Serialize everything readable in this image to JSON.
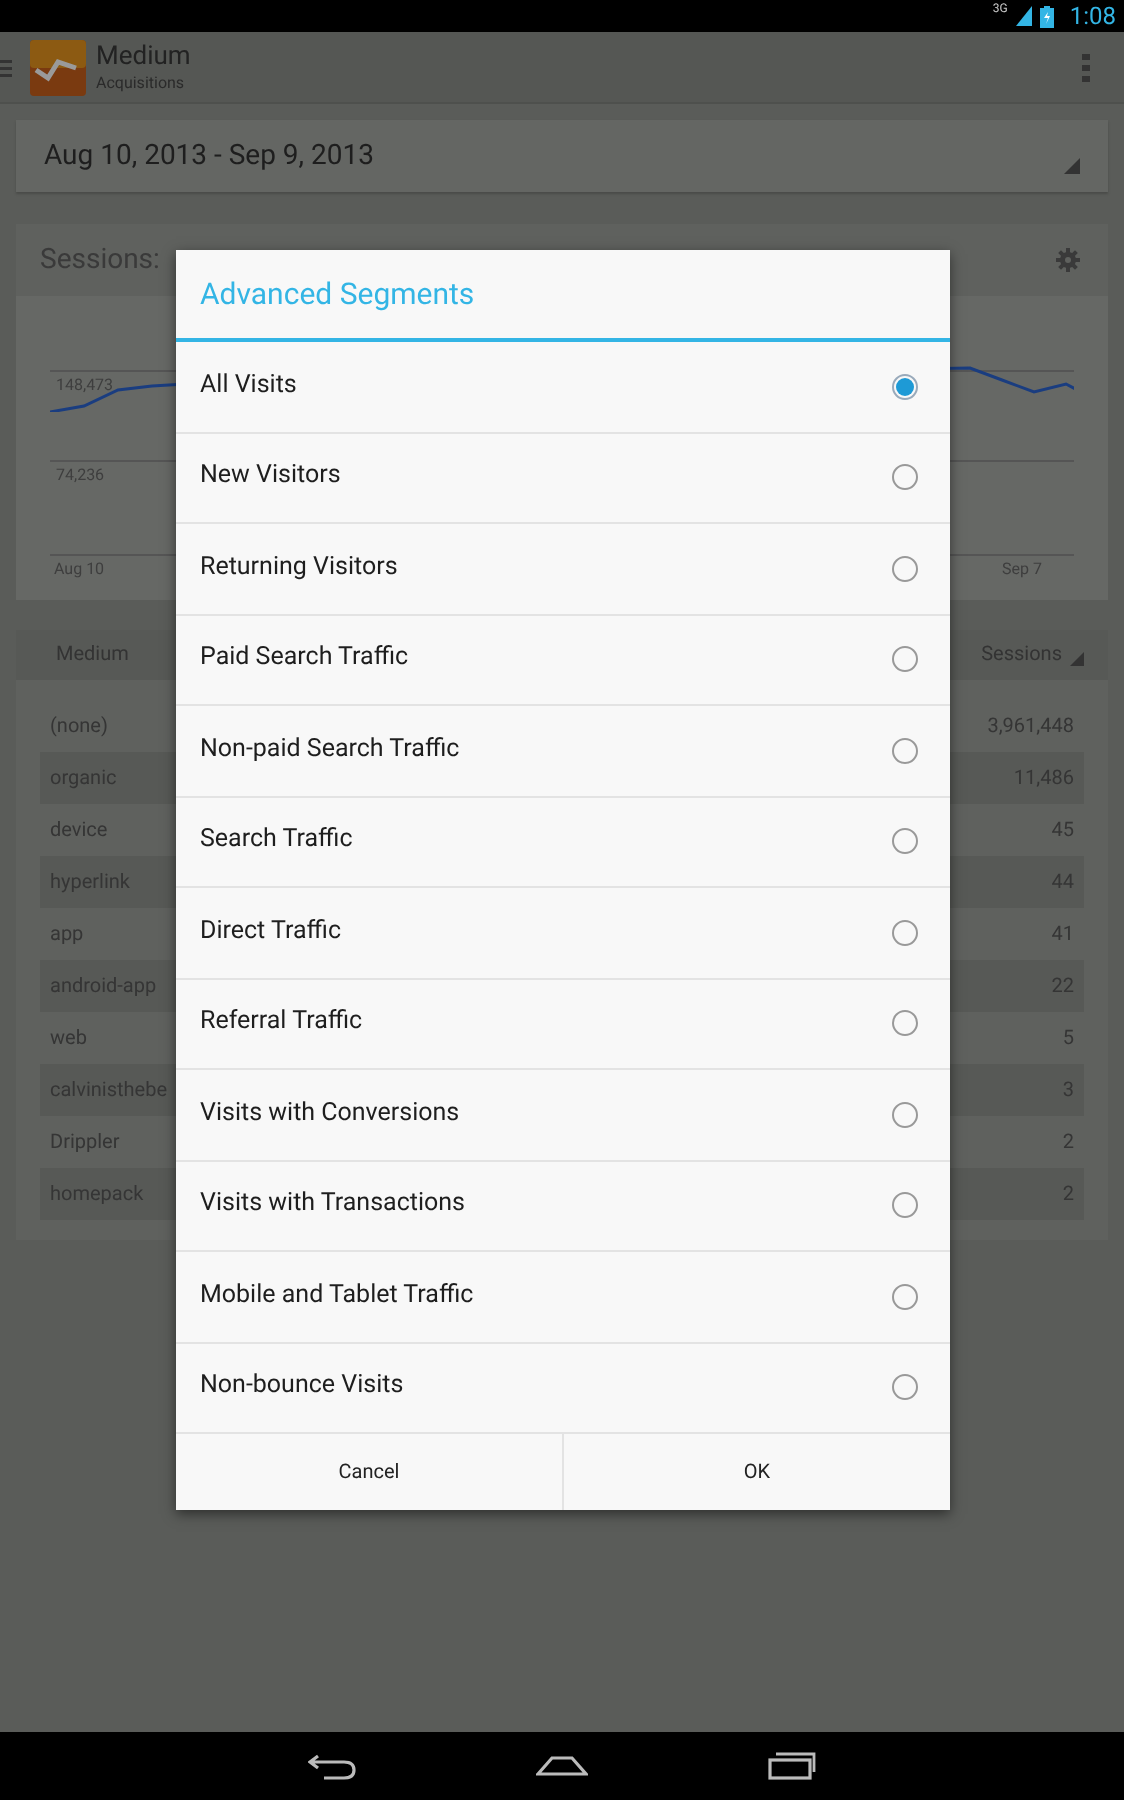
{
  "status_bar": {
    "network": "3G",
    "time": "1:08"
  },
  "action_bar": {
    "title": "Medium",
    "subtitle": "Acquisitions"
  },
  "date_range": "Aug 10, 2013 - Sep 9, 2013",
  "sessions_label": "Sessions:",
  "chart": {
    "y_labels": [
      "148,473",
      "74,236"
    ],
    "x_labels": [
      "Aug 10",
      "Sep 7"
    ]
  },
  "table": {
    "columns": [
      "Medium",
      "Sessions"
    ],
    "rows": [
      {
        "medium": "(none)",
        "sessions": "3,961,448"
      },
      {
        "medium": "organic",
        "sessions": "11,486"
      },
      {
        "medium": "device",
        "sessions": "45"
      },
      {
        "medium": "hyperlink",
        "sessions": "44"
      },
      {
        "medium": "app",
        "sessions": "41"
      },
      {
        "medium": "android-app",
        "sessions": "22"
      },
      {
        "medium": "web",
        "sessions": "5"
      },
      {
        "medium": "calvinisthebe",
        "sessions": "3"
      },
      {
        "medium": "Drippler",
        "sessions": "2"
      },
      {
        "medium": "homepack",
        "sessions": "2"
      }
    ]
  },
  "dialog": {
    "title": "Advanced Segments",
    "options": [
      {
        "label": "All Visits",
        "selected": true
      },
      {
        "label": "New Visitors",
        "selected": false
      },
      {
        "label": "Returning Visitors",
        "selected": false
      },
      {
        "label": "Paid Search Traffic",
        "selected": false
      },
      {
        "label": "Non-paid Search Traffic",
        "selected": false
      },
      {
        "label": "Search Traffic",
        "selected": false
      },
      {
        "label": "Direct Traffic",
        "selected": false
      },
      {
        "label": "Referral Traffic",
        "selected": false
      },
      {
        "label": "Visits with Conversions",
        "selected": false
      },
      {
        "label": "Visits with Transactions",
        "selected": false
      },
      {
        "label": "Mobile and Tablet Traffic",
        "selected": false
      },
      {
        "label": "Non-bounce Visits",
        "selected": false
      }
    ],
    "buttons": [
      "Cancel",
      "OK"
    ]
  }
}
